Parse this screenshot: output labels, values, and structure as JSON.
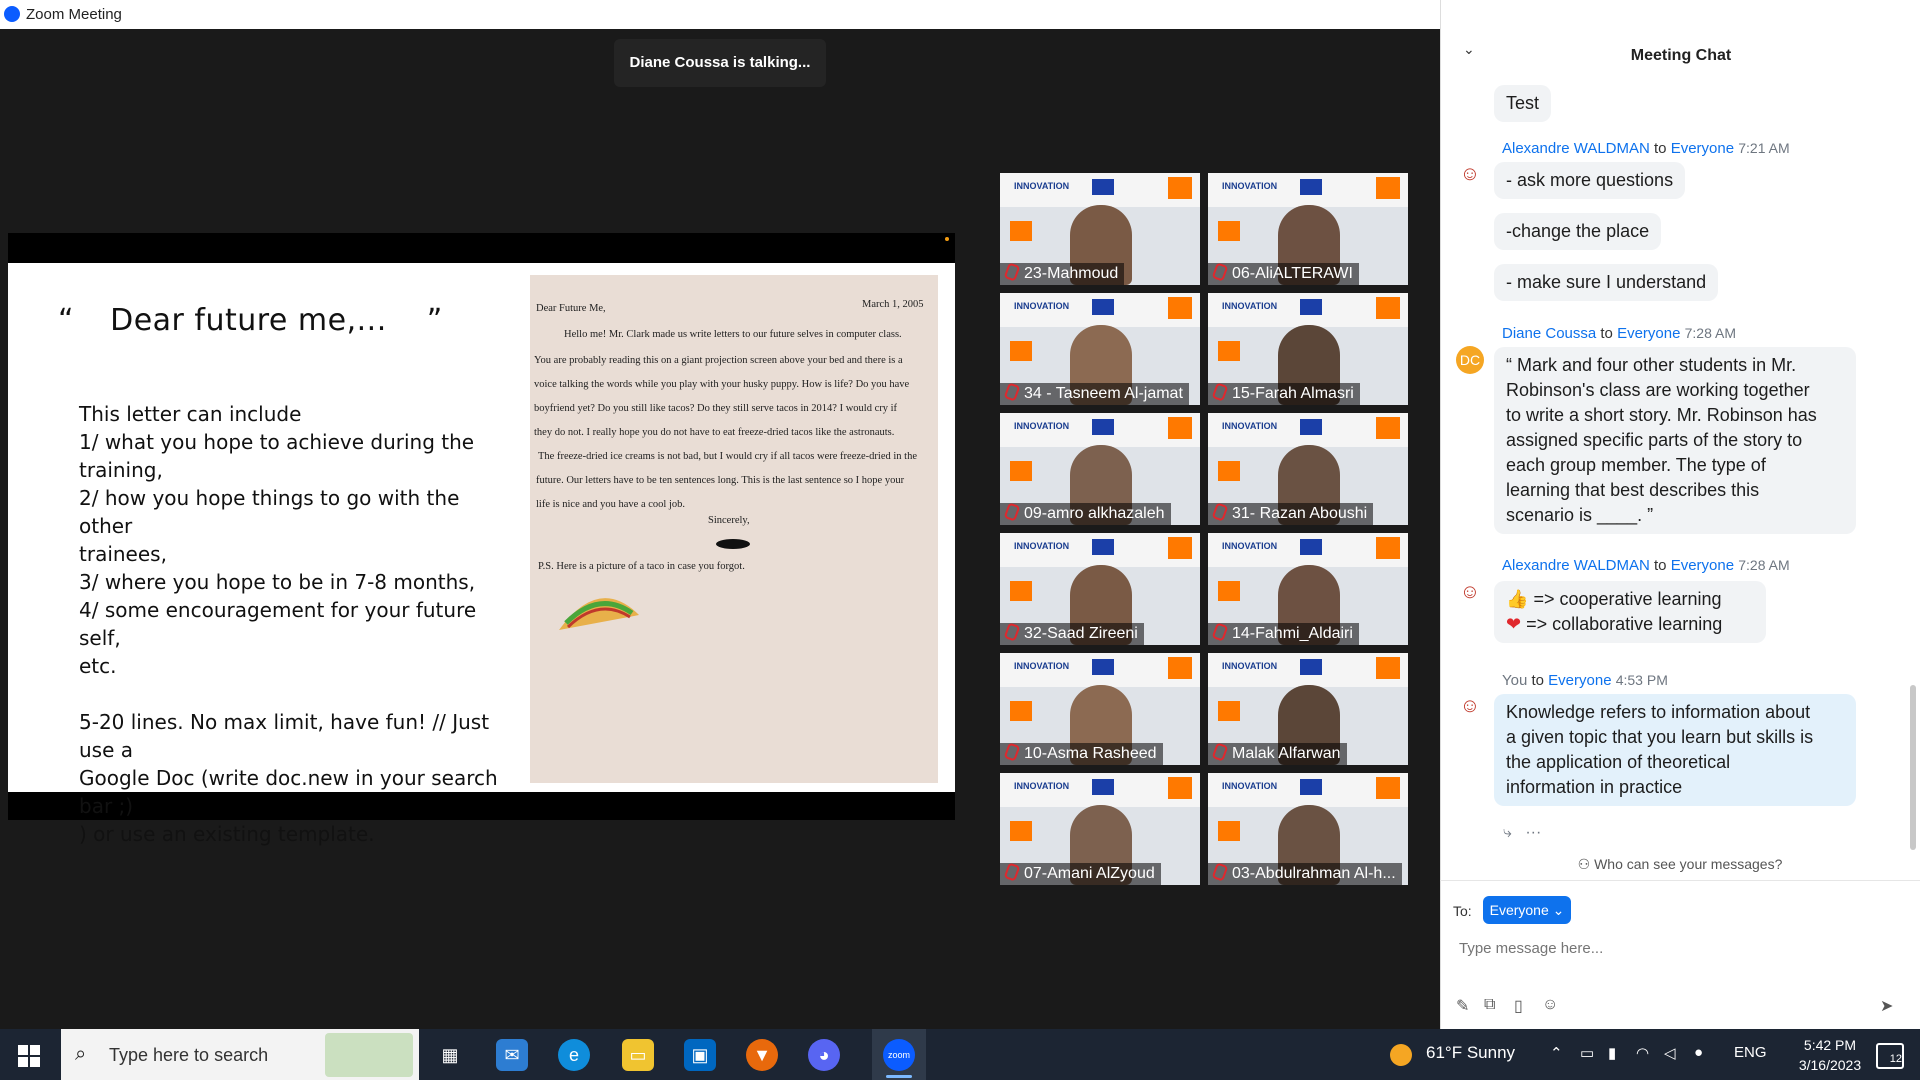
{
  "window": {
    "title": "Zoom Meeting"
  },
  "meeting": {
    "talking_indicator": "Diane Coussa is talking...",
    "slide": {
      "title_open": "“",
      "title": "Dear future me,...",
      "title_close": "”",
      "body_lines": [
        "This letter can include",
        "1/ what you hope to achieve during the training,",
        "2/ how you hope things to go with the other",
        "trainees,",
        "3/ where you hope to be in 7-8 months,",
        "4/ some encouragement for your future self,",
        "etc."
      ],
      "body_footer_lines": [
        "5-20 lines. No max limit, have fun! // Just use a",
        "Google Doc (write doc.new in your search bar ;)",
        ") or use an existing template."
      ],
      "letter": {
        "date": "March 1, 2005",
        "greeting": "Dear Future Me,",
        "lines": [
          "Hello me! Mr. Clark made us write letters to our future selves in computer class.",
          "You are probably reading this on a giant projection screen above your bed and there is a",
          "voice talking the words while you play with your husky puppy. How is life? Do you have",
          "boyfriend yet? Do you still like tacos? Do they still serve tacos in 2014? I would cry if",
          "they do not. I really hope you do not have to eat freeze-dried tacos like the astronauts.",
          "The freeze-dried ice creams is not bad, but I would cry if all tacos were freeze-dried in the",
          "future. Our letters have to be ten sentences long. This is the last sentence so I hope your",
          "life is nice and you have a cool job."
        ],
        "closing": "Sincerely,",
        "ps": "P.S. Here is a picture of a taco in case you forgot."
      }
    },
    "participants": [
      "23-Mahmoud",
      "06-AliALTERAWI",
      "34 - Tasneem Al-jamat",
      "15-Farah Almasri",
      "09-amro alkhazaleh",
      "31- Razan Aboushi",
      "32-Saad Zireeni",
      "14-Fahmi_Aldairi",
      "10-Asma Rasheed",
      "Malak Alfarwan",
      "07-Amani AlZyoud",
      "03-Abdulrahman Al-h..."
    ],
    "tile_banner_text": "INNOVATION"
  },
  "chat": {
    "title": "Meeting Chat",
    "messages": [
      {
        "text": "Test"
      },
      {
        "sender": "Alexandre WALDMAN",
        "to_word": "to",
        "to": "Everyone",
        "time": "7:21 AM"
      },
      {
        "text": "- ask more questions"
      },
      {
        "text": "-change the place"
      },
      {
        "text": "- make sure I understand"
      },
      {
        "sender": "Diane Coussa",
        "to_word": "to",
        "to": "Everyone",
        "time": "7:28 AM",
        "avatar": "DC",
        "lines": [
          "“ Mark and four other students in Mr.",
          "Robinson's class are working together",
          "to write a short story. Mr. Robinson has",
          "assigned specific parts of the story to",
          "each group member. The type of",
          "learning that best describes this",
          "scenario is ____. ”"
        ]
      },
      {
        "sender": "Alexandre WALDMAN",
        "to_word": "to",
        "to": "Everyone",
        "time": "7:28 AM",
        "lines": [
          "=> cooperative learning",
          "=> collaborative learning"
        ]
      },
      {
        "sender": "You",
        "to_word": "to",
        "to": "Everyone",
        "time": "4:53 PM",
        "lines": [
          "Knowledge refers to information about",
          "a given topic that you learn but skills is",
          "the application of theoretical",
          "information in practice"
        ]
      }
    ],
    "who_can_see": "Who can see your messages?",
    "to_label": "To:",
    "to_value": "Everyone",
    "input_placeholder": "Type message here..."
  },
  "taskbar": {
    "search_placeholder": "Type here to search",
    "weather": "61°F  Sunny",
    "language": "ENG",
    "time": "5:42 PM",
    "date": "3/16/2023",
    "notifications": "12"
  },
  "colors": {
    "accent": "#0e72ed",
    "bg": "#1a1a1a",
    "mine_bubble": "#e3f1fb"
  }
}
